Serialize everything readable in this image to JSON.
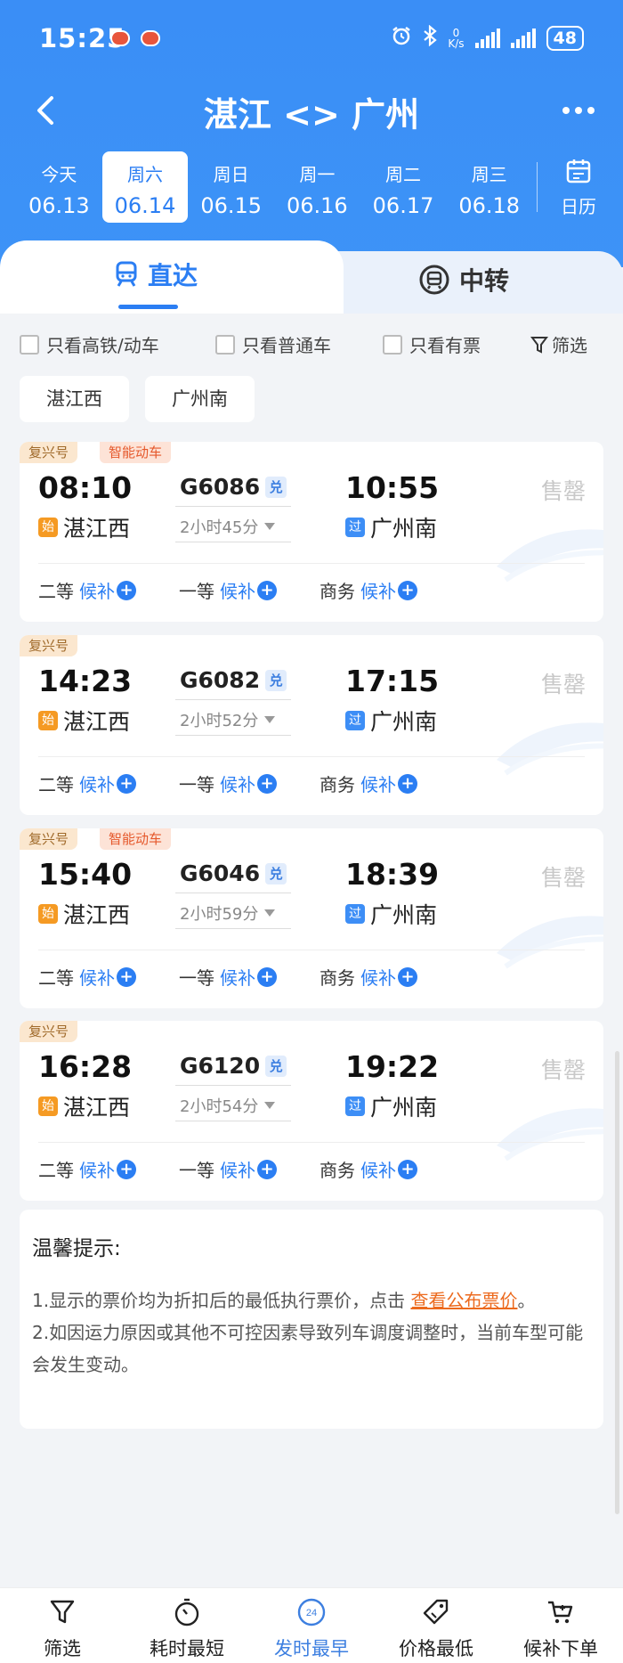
{
  "status_bar": {
    "time": "15:25",
    "net_speed_top": "0",
    "net_speed_unit": "K/s",
    "battery": "48"
  },
  "nav": {
    "title": "湛江 <> 广州"
  },
  "dates": [
    {
      "day": "今天",
      "date": "06.13"
    },
    {
      "day": "周六",
      "date": "06.14",
      "active": true
    },
    {
      "day": "周日",
      "date": "06.15"
    },
    {
      "day": "周一",
      "date": "06.16"
    },
    {
      "day": "周二",
      "date": "06.17"
    },
    {
      "day": "周三",
      "date": "06.18"
    }
  ],
  "calendar_label": "日历",
  "tabs": {
    "direct": "直达",
    "transfer": "中转"
  },
  "filters": {
    "high_speed": "只看高铁/动车",
    "normal": "只看普通车",
    "available": "只看有票",
    "filter": "筛选"
  },
  "stations": {
    "from": "湛江西",
    "to": "广州南"
  },
  "trains": [
    {
      "tags": [
        "复兴号",
        "智能动车"
      ],
      "dep_time": "08:10",
      "arr_time": "10:55",
      "number": "G6086",
      "exchange": "兑",
      "duration": "2小时45分",
      "dep_badge": "始",
      "dep_station": "湛江西",
      "arr_badge": "过",
      "arr_station": "广州南",
      "status": "售罄",
      "seats": [
        {
          "class": "二等",
          "state": "候补"
        },
        {
          "class": "一等",
          "state": "候补"
        },
        {
          "class": "商务",
          "state": "候补"
        }
      ]
    },
    {
      "tags": [
        "复兴号"
      ],
      "dep_time": "14:23",
      "arr_time": "17:15",
      "number": "G6082",
      "exchange": "兑",
      "duration": "2小时52分",
      "dep_badge": "始",
      "dep_station": "湛江西",
      "arr_badge": "过",
      "arr_station": "广州南",
      "status": "售罄",
      "seats": [
        {
          "class": "二等",
          "state": "候补"
        },
        {
          "class": "一等",
          "state": "候补"
        },
        {
          "class": "商务",
          "state": "候补"
        }
      ]
    },
    {
      "tags": [
        "复兴号",
        "智能动车"
      ],
      "dep_time": "15:40",
      "arr_time": "18:39",
      "number": "G6046",
      "exchange": "兑",
      "duration": "2小时59分",
      "dep_badge": "始",
      "dep_station": "湛江西",
      "arr_badge": "过",
      "arr_station": "广州南",
      "status": "售罄",
      "seats": [
        {
          "class": "二等",
          "state": "候补"
        },
        {
          "class": "一等",
          "state": "候补"
        },
        {
          "class": "商务",
          "state": "候补"
        }
      ]
    },
    {
      "tags": [
        "复兴号"
      ],
      "dep_time": "16:28",
      "arr_time": "19:22",
      "number": "G6120",
      "exchange": "兑",
      "duration": "2小时54分",
      "dep_badge": "始",
      "dep_station": "湛江西",
      "arr_badge": "过",
      "arr_station": "广州南",
      "status": "售罄",
      "seats": [
        {
          "class": "二等",
          "state": "候补"
        },
        {
          "class": "一等",
          "state": "候补"
        },
        {
          "class": "商务",
          "state": "候补"
        }
      ]
    }
  ],
  "tips": {
    "title": "温馨提示:",
    "line1_pre": "1.显示的票价均为折扣后的最低执行票价，点击",
    "line1_link": "查看公布票价",
    "line1_post": "。",
    "line2": "2.如因运力原因或其他不可控因素导致列车调度调整时，当前车型可能会发生变动。"
  },
  "bottom_bar": [
    {
      "label": "筛选",
      "icon": "funnel-icon"
    },
    {
      "label": "耗时最短",
      "icon": "stopwatch-icon"
    },
    {
      "label": "发时最早",
      "icon": "clock-24-icon",
      "active": true
    },
    {
      "label": "价格最低",
      "icon": "price-tag-icon"
    },
    {
      "label": "候补下单",
      "icon": "cart-plus-icon"
    }
  ],
  "bottom_icon_text": "24",
  "colors": {
    "primary": "#3d8ef6",
    "accent_orange": "#ec6a1e",
    "sold_out": "#c8c8c8"
  }
}
